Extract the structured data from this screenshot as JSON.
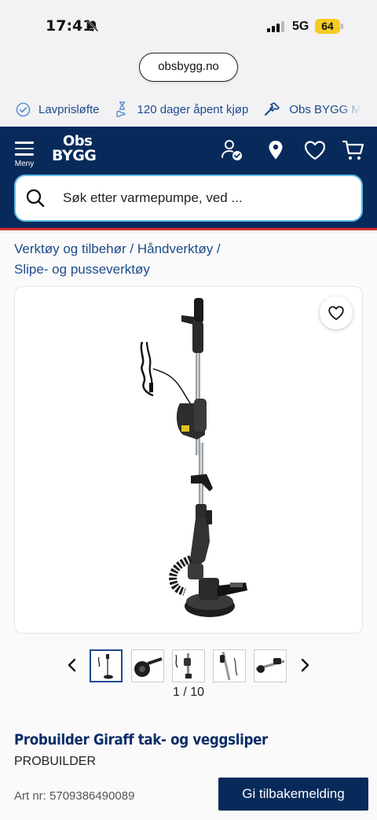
{
  "status_bar": {
    "time": "17:41",
    "network": "5G",
    "battery": "64"
  },
  "browser": {
    "url": "obsbygg.no"
  },
  "usp_bar": {
    "items": [
      "Lavprisløfte",
      "120 dager åpent kjøp",
      "Obs BYGG M"
    ]
  },
  "header": {
    "menu_label": "Meny",
    "logo_line1": "Obs",
    "logo_line2": "BYGG",
    "search_placeholder": "Søk etter varmepumpe, ved ..."
  },
  "breadcrumb": {
    "line1": "Verktøy og tilbehør / Håndverktøy /",
    "line2": "Slipe- og pusseverktøy"
  },
  "gallery": {
    "counter": "1 / 10",
    "thumbnail_count": 5,
    "active_index": 0
  },
  "product": {
    "title": "Probuilder Giraff tak- og veggsliper",
    "brand": "PROBUILDER",
    "art_nr": "Art nr: 5709386490089"
  },
  "actions": {
    "feedback_label": "Gi tilbakemelding"
  },
  "colors": {
    "navy": "#082a5a",
    "link_blue": "#1d4a8c",
    "accent_red": "#d92b2b",
    "search_border": "#5fb9e6",
    "battery": "#f6cc20"
  }
}
